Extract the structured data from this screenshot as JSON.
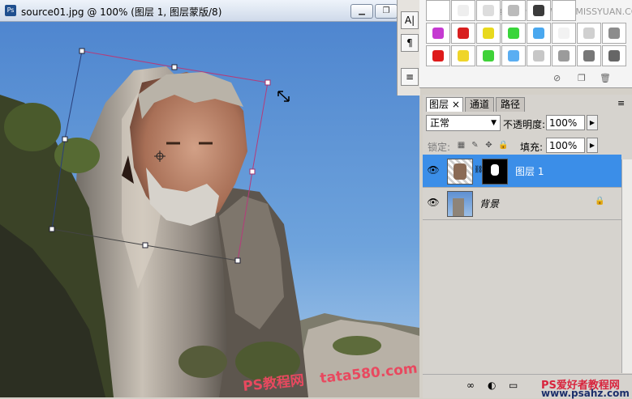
{
  "document": {
    "title": "source01.jpg @ 100% (图层 1, 图层蒙版/8)",
    "badge": "Ps",
    "window_buttons": [
      "minimize",
      "restore"
    ]
  },
  "styles_panel": {
    "watermark": "思缘设计论坛 WWW.MISSYUAN.COM",
    "rows": [
      [
        "#ffffff",
        "#eeeeee",
        "#dddddd",
        "#bbbbbb",
        "#3b3b3b",
        "#ffffff"
      ],
      [
        "#c53ad1",
        "#d81f1f",
        "#e8d91d",
        "#39d53a",
        "#4aa8ef",
        "#f2f2f2",
        "#d0d0d0",
        "#8c8c8c"
      ],
      [
        "#de1a1a",
        "#efd52a",
        "#3fd238",
        "#5aaef2",
        "#c7c7c7",
        "#9b9b9b",
        "#777777",
        "#666666"
      ]
    ]
  },
  "tool_column": {
    "items": [
      "A|",
      "¶",
      "≡"
    ]
  },
  "layers_panel": {
    "tabs": [
      {
        "label": "图层",
        "close": "×"
      },
      {
        "label": "通道"
      },
      {
        "label": "路径"
      }
    ],
    "blend_mode": "正常",
    "opacity_label": "不透明度:",
    "opacity_value": "100%",
    "lock_label": "锁定:",
    "fill_label": "填充:",
    "fill_value": "100%",
    "layers": [
      {
        "name": "图层 1",
        "selected": true,
        "has_mask": true
      },
      {
        "name": "背景",
        "selected": false,
        "locked": true
      }
    ]
  },
  "watermarks": {
    "left": "PS教程网",
    "middle": "tata580.com",
    "right_cn": "PS爱好者教程网",
    "right_url": "www.psahz.com"
  }
}
